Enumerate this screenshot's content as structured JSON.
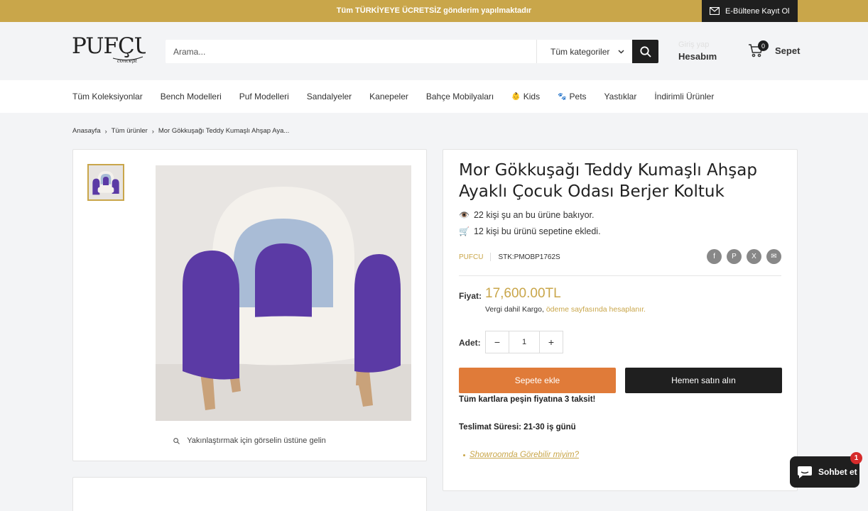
{
  "announcement": {
    "text": "Tüm TÜRKİYEYE ÜCRETSİZ gönderim yapılmaktadır",
    "newsletter_label": "E-Bültene Kayıt Ol"
  },
  "header": {
    "logo_text": "PUFÇU",
    "logo_sub": "concept",
    "search_placeholder": "Arama...",
    "category_label": "Tüm kategoriler",
    "account_login": "Giriş yap",
    "account_label": "Hesabım",
    "cart_count": "0",
    "cart_label": "Sepet"
  },
  "nav": {
    "items": [
      {
        "label": "Tüm Koleksiyonlar"
      },
      {
        "label": "Bench Modelleri"
      },
      {
        "label": "Puf Modelleri"
      },
      {
        "label": "Sandalyeler"
      },
      {
        "label": "Kanepeler"
      },
      {
        "label": "Bahçe Mobilyaları"
      },
      {
        "label": "Kids",
        "icon": "👶"
      },
      {
        "label": "Pets",
        "icon": "🐾"
      },
      {
        "label": "Yastıklar"
      },
      {
        "label": "İndirimli Ürünler"
      }
    ]
  },
  "breadcrumb": {
    "home": "Anasayfa",
    "all": "Tüm ürünler",
    "current": "Mor Gökkuşağı Teddy Kumaşlı Ahşap Aya..."
  },
  "gallery": {
    "zoom_hint": "Yakınlaştırmak için görselin üstüne gelin"
  },
  "product": {
    "title": "Mor Gökkuşağı Teddy Kumaşlı Ahşap Ayaklı Çocuk Odası Berjer Koltuk",
    "viewers": "22 kişi şu an bu ürüne bakıyor.",
    "carted": "12 kişi bu ürünü sepetine ekledi.",
    "vendor": "PUFCU",
    "sku": "STK:PMOBP1762S",
    "price_label": "Fiyat:",
    "price": "17,600.00TL",
    "tax_text": "Vergi dahil Kargo,",
    "tax_link": "ödeme sayfasında hesaplanır.",
    "qty_label": "Adet:",
    "qty_value": "1",
    "add_to_cart": "Sepete ekle",
    "buy_now": "Hemen satın alın",
    "installment": "Tüm kartlara peşin fiyatına 3 taksit!",
    "delivery": "Teslimat Süresi: 21-30 iş günü",
    "showroom": "Showroomda Görebilir miyim?"
  },
  "share": {
    "facebook": "f",
    "pinterest": "P",
    "twitter": "X",
    "email": "✉"
  },
  "chat": {
    "label": "Sohbet et",
    "badge": "1"
  },
  "colors": {
    "accent": "#c9a64a",
    "add_button": "#e07b39",
    "dark": "#1f1f1f"
  }
}
